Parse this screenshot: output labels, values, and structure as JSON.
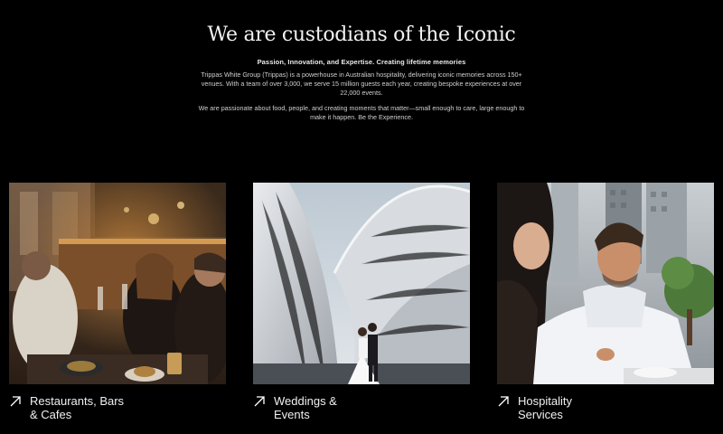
{
  "intro": {
    "headline": "We are custodians of the Iconic",
    "tagline": "Passion, Innovation, and Expertise. Creating lifetime memories",
    "paragraph_1": "Trippas White Group (Trippas) is a powerhouse in Australian hospitality, delivering iconic memories across 150+ venues. With a team of over 3,000, we serve 15 million guests each year, creating bespoke experiences at over 22,000 events.",
    "paragraph_2": "We are passionate about food, people, and creating moments that matter—small enough to care, large enough to make it happen. Be the Experience."
  },
  "cards": [
    {
      "label": "Restaurants, Bars & Cafes",
      "image": "restaurant-diners-photo",
      "icon": "arrow-up-right-icon"
    },
    {
      "label": "Weddings & Events",
      "image": "opera-house-wedding-photo",
      "icon": "arrow-up-right-icon"
    },
    {
      "label": "Hospitality Services",
      "image": "outdoor-dining-couple-photo",
      "icon": "arrow-up-right-icon"
    }
  ],
  "colors": {
    "background": "#000000",
    "text": "#ffffff"
  }
}
